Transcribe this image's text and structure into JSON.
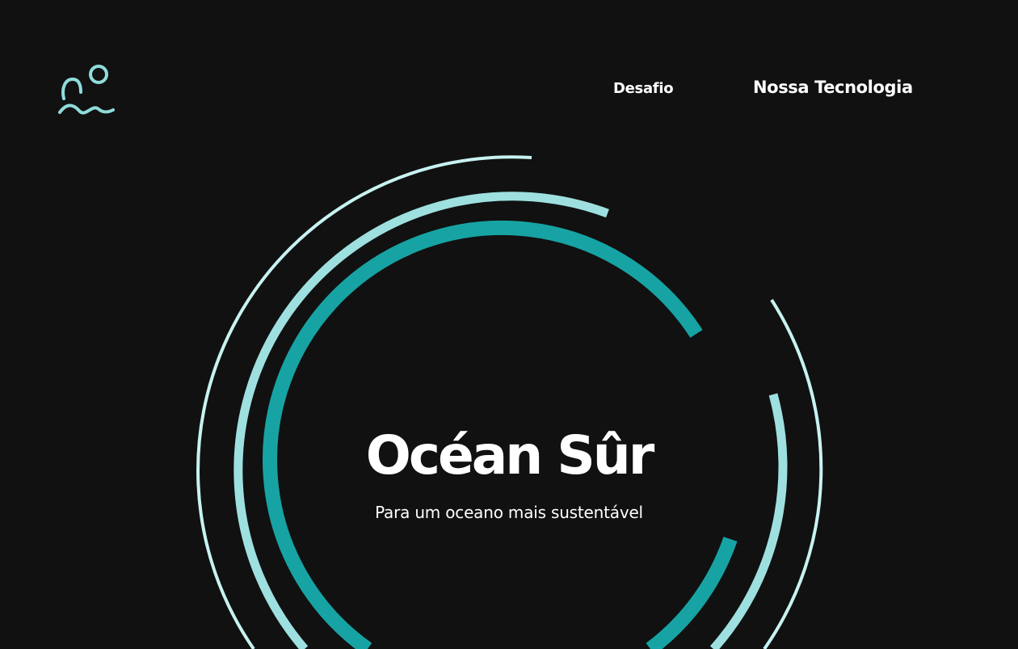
{
  "brand": {
    "logo_icon": "swimmer-waves-logo-icon",
    "accent_color": "#8fdcdc"
  },
  "nav": {
    "items": [
      {
        "label": "Desafio"
      },
      {
        "label": "Nossa Tecnologia"
      }
    ]
  },
  "hero": {
    "title": "Océan Sûr",
    "subtitle": "Para um oceano mais sustentável"
  },
  "theme": {
    "background": "#111111",
    "ring_colors": [
      "#c8f2f2",
      "#9ee0e0",
      "#17a3a3"
    ]
  }
}
